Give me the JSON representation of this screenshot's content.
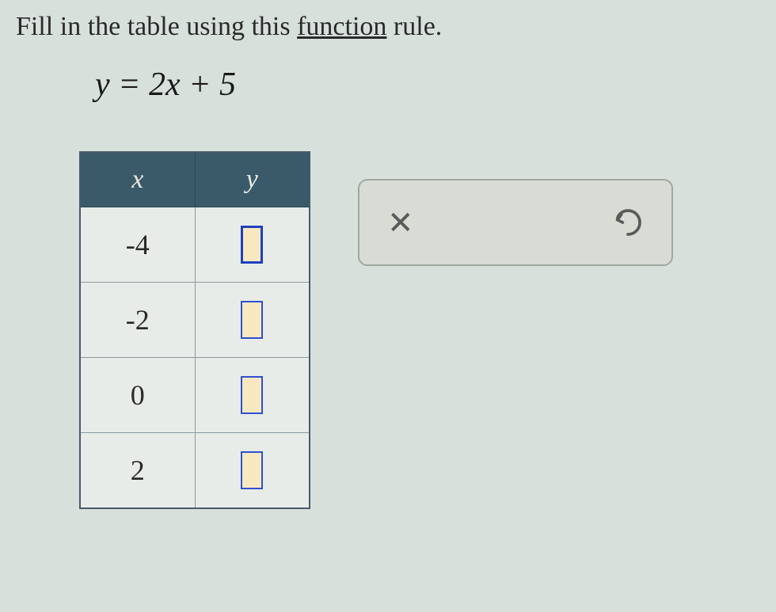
{
  "instruction": {
    "prefix": "Fill in the table using this ",
    "link": "function",
    "suffix": " rule."
  },
  "equation": "y = 2x + 5",
  "table": {
    "headers": {
      "x": "x",
      "y": "y"
    },
    "rows": [
      {
        "x": "-4",
        "y": ""
      },
      {
        "x": "-2",
        "y": ""
      },
      {
        "x": "0",
        "y": ""
      },
      {
        "x": "2",
        "y": ""
      }
    ]
  },
  "controls": {
    "close": "×",
    "undo": "undo"
  }
}
